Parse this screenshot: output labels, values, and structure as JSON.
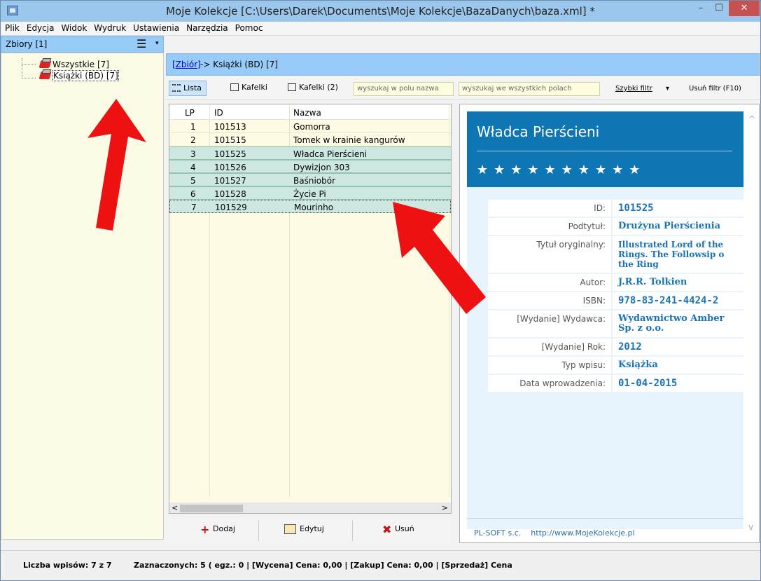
{
  "window": {
    "title": "Moje Kolekcje [C:\\Users\\Darek\\Documents\\Moje Kolekcje\\BazaDanych\\baza.xml] *",
    "min_label": "–",
    "max_label": "☐",
    "close_label": "✕"
  },
  "menu": [
    "Plik",
    "Edycja",
    "Widok",
    "Wydruk",
    "Ustawienia",
    "Narzędzia",
    "Pomoc"
  ],
  "left": {
    "header": "Zbiory [1]",
    "menu_icon": "☰",
    "dropdown_icon": "▾",
    "tree": [
      "Wszystkie [7]",
      "Książki (BD) [7]"
    ]
  },
  "breadcrumb": {
    "link": "[Zbiór]",
    "rest": " -> Książki (BD) [7]"
  },
  "toolbar": {
    "view_list": "Lista",
    "view_tiles": "Kafelki",
    "view_tiles2": "Kafelki (2)",
    "search_name_placeholder": "wyszukaj w polu nazwa",
    "search_all_placeholder": "wyszukaj we wszystkich polach",
    "quick_filter": "Szybki filtr",
    "quick_filter_arrow": "▾",
    "remove_filter": "Usuń filtr (F10)"
  },
  "grid": {
    "columns": [
      "LP",
      "ID",
      "Nazwa"
    ],
    "rows": [
      {
        "lp": "1",
        "id": "101513",
        "name": "Gomorra"
      },
      {
        "lp": "2",
        "id": "101515",
        "name": "Tomek w krainie kangurów"
      },
      {
        "lp": "3",
        "id": "101525",
        "name": "Władca Pierścieni"
      },
      {
        "lp": "4",
        "id": "101526",
        "name": "Dywizjon 303"
      },
      {
        "lp": "5",
        "id": "101527",
        "name": "Baśniobór"
      },
      {
        "lp": "6",
        "id": "101528",
        "name": "Życie Pi"
      },
      {
        "lp": "7",
        "id": "101529",
        "name": "Mourinho"
      }
    ],
    "scroll_left": "<",
    "scroll_right": ">"
  },
  "actions": {
    "add": "Dodaj",
    "edit": "Edytuj",
    "delete": "Usuń",
    "add_icon": "+",
    "delete_icon": "✖"
  },
  "detail": {
    "title": "Władca Pierścieni",
    "stars": "★★★★★★★★★★",
    "fields": [
      {
        "label": "ID:",
        "value": "101525"
      },
      {
        "label": "Podtytuł:",
        "value": "Drużyna Pierścienia"
      },
      {
        "label": "Tytuł oryginalny:",
        "value": "Illustrated Lord of the\nRings. The Followsip o\nthe Ring"
      },
      {
        "label": "Autor:",
        "value": "J.R.R. Tolkien"
      },
      {
        "label": "ISBN:",
        "value": "978-83-241-4424-2"
      },
      {
        "label": "[Wydanie] Wydawca:",
        "value": "Wydawnictwo Amber\nSp. z o.o."
      },
      {
        "label": "[Wydanie] Rok:",
        "value": "2012"
      },
      {
        "label": "Typ wpisu:",
        "value": "Książka"
      },
      {
        "label": "Data wprowadzenia:",
        "value": "01-04-2015"
      }
    ],
    "footer": "PL-SOFT s.c.    http://www.MojeKolekcje.pl",
    "scroll_up": "^",
    "scroll_down": "v"
  },
  "status": {
    "count": "Liczba wpisów: 7 z 7",
    "details": "Zaznaczonych: 5 ( egz.: 0  |  [Wycena] Cena: 0,00  |  [Zakup] Cena: 0,00  |  [Sprzedaż] Cena"
  },
  "colors": {
    "accent": "#98ccf8",
    "detail_header": "#0e76b3",
    "arrow": "#ee1111",
    "selection": "#cce8e0"
  }
}
